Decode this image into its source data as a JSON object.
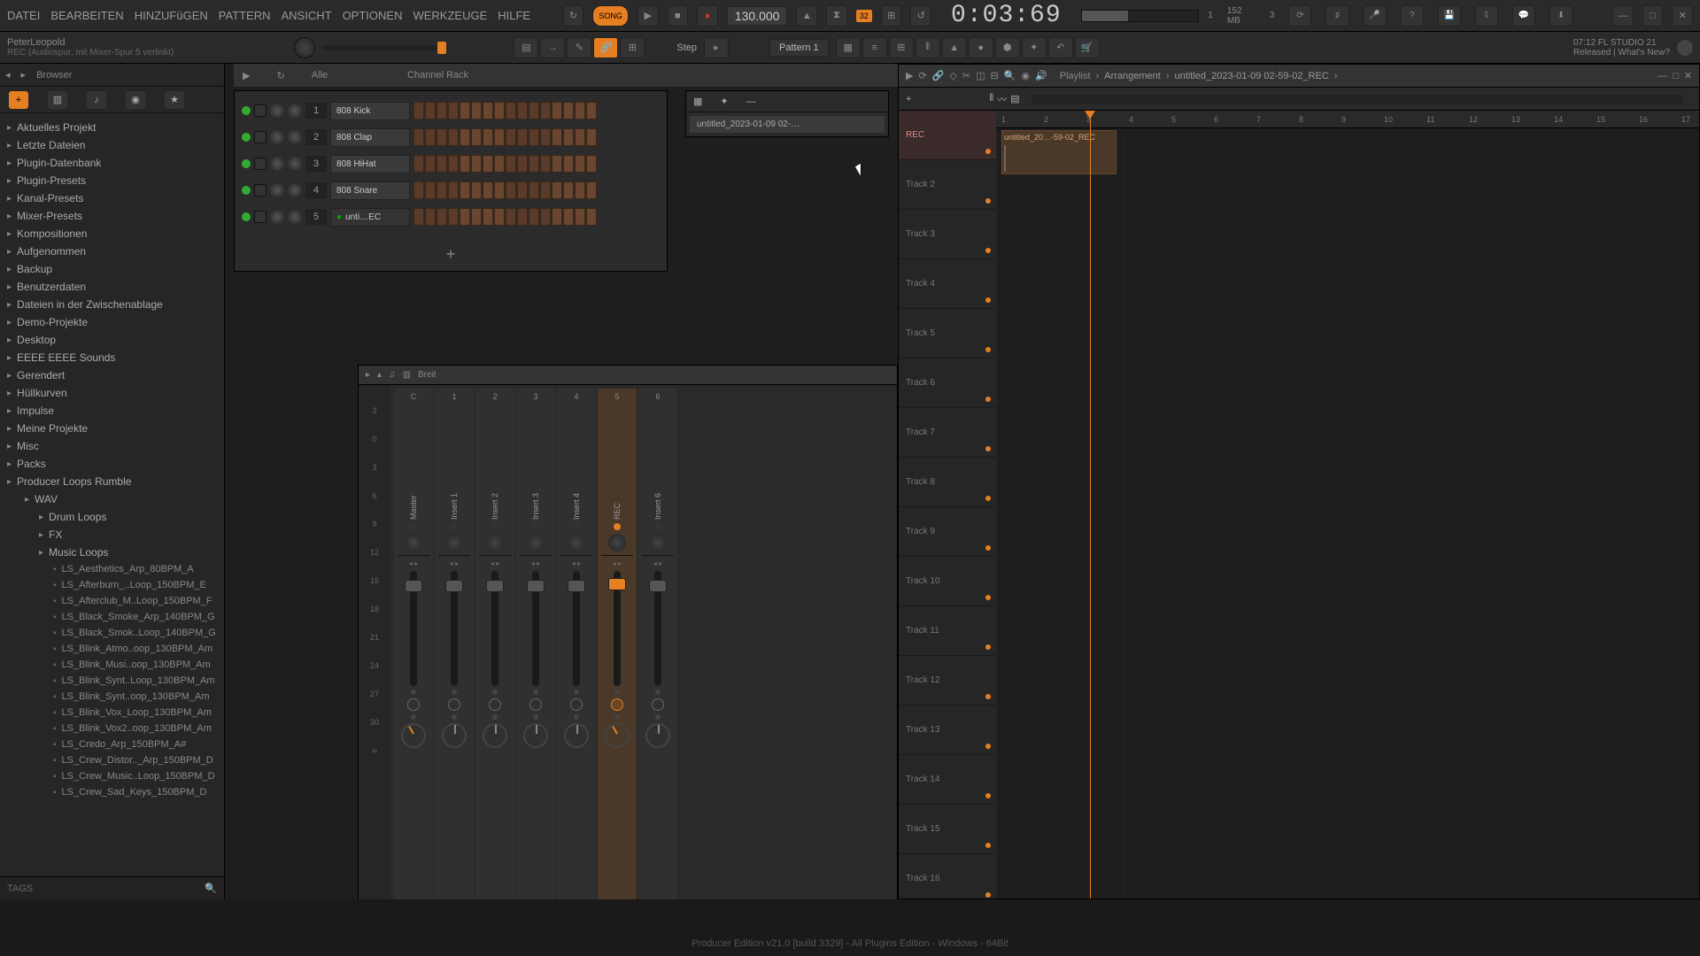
{
  "menu": {
    "items": [
      "DATEI",
      "BEARBEITEN",
      "HINZUFüGEN",
      "PATTERN",
      "ANSICHT",
      "OPTIONEN",
      "WERKZEUGE",
      "HILFE"
    ]
  },
  "transport": {
    "song_label": "SONG",
    "tempo": "130.000",
    "time": "0:03:69",
    "snap_label": "32"
  },
  "stats": {
    "voices": "1",
    "mem": "152 MB",
    "cpu": "3"
  },
  "hint": {
    "title": "PeterLeopold",
    "sub": "REC (Audiospur, mit Mixer-Spur 5 verlinkt)"
  },
  "step_label": "Step",
  "pattern_selector": "Pattern 1",
  "about": {
    "line1": "07:12  FL STUDIO 21",
    "line2": "Released | What's New?"
  },
  "browser": {
    "title": "Browser",
    "filter_label": "Alle",
    "tree": [
      {
        "label": "Aktuelles Projekt",
        "lvl": 0
      },
      {
        "label": "Letzte Dateien",
        "lvl": 0
      },
      {
        "label": "Plugin-Datenbank",
        "lvl": 0
      },
      {
        "label": "Plugin-Presets",
        "lvl": 0
      },
      {
        "label": "Kanal-Presets",
        "lvl": 0
      },
      {
        "label": "Mixer-Presets",
        "lvl": 0
      },
      {
        "label": "Kompositionen",
        "lvl": 0
      },
      {
        "label": "Aufgenommen",
        "lvl": 0
      },
      {
        "label": "Backup",
        "lvl": 0
      },
      {
        "label": "Benutzerdaten",
        "lvl": 0
      },
      {
        "label": "Dateien in der Zwischenablage",
        "lvl": 0
      },
      {
        "label": "Demo-Projekte",
        "lvl": 0
      },
      {
        "label": "Desktop",
        "lvl": 0
      },
      {
        "label": "EEEE EEEE Sounds",
        "lvl": 0
      },
      {
        "label": "Gerendert",
        "lvl": 0
      },
      {
        "label": "Hüllkurven",
        "lvl": 0
      },
      {
        "label": "Impulse",
        "lvl": 0
      },
      {
        "label": "Meine Projekte",
        "lvl": 0
      },
      {
        "label": "Misc",
        "lvl": 0
      },
      {
        "label": "Packs",
        "lvl": 0
      },
      {
        "label": "Producer Loops Rumble",
        "lvl": 0
      },
      {
        "label": "WAV",
        "lvl": 1
      },
      {
        "label": "Drum Loops",
        "lvl": 2
      },
      {
        "label": "FX",
        "lvl": 2
      },
      {
        "label": "Music Loops",
        "lvl": 2
      },
      {
        "label": "LS_Aesthetics_Arp_80BPM_A",
        "lvl": 3
      },
      {
        "label": "LS_Afterburn_..Loop_150BPM_E",
        "lvl": 3
      },
      {
        "label": "LS_Afterclub_M..Loop_150BPM_F",
        "lvl": 3
      },
      {
        "label": "LS_Black_Smoke_Arp_140BPM_G",
        "lvl": 3
      },
      {
        "label": "LS_Black_Smok..Loop_140BPM_G",
        "lvl": 3
      },
      {
        "label": "LS_Blink_Atmo..oop_130BPM_Am",
        "lvl": 3
      },
      {
        "label": "LS_Blink_Musi..oop_130BPM_Am",
        "lvl": 3
      },
      {
        "label": "LS_Blink_Synt..Loop_130BPM_Am",
        "lvl": 3
      },
      {
        "label": "LS_Blink_Synt..oop_130BPM_Am",
        "lvl": 3
      },
      {
        "label": "LS_Blink_Vox_Loop_130BPM_Am",
        "lvl": 3
      },
      {
        "label": "LS_Blink_Vox2..oop_130BPM_Am",
        "lvl": 3
      },
      {
        "label": "LS_Credo_Arp_150BPM_A#",
        "lvl": 3
      },
      {
        "label": "LS_Crew_Distor.._Arp_150BPM_D",
        "lvl": 3
      },
      {
        "label": "LS_Crew_Music..Loop_150BPM_D",
        "lvl": 3
      },
      {
        "label": "LS_Crew_Sad_Keys_150BPM_D",
        "lvl": 3
      }
    ],
    "tags_label": "TAGS"
  },
  "channel_rack": {
    "title": "Channel Rack",
    "channels": [
      {
        "num": "1",
        "name": "808 Kick"
      },
      {
        "num": "2",
        "name": "808 Clap"
      },
      {
        "num": "3",
        "name": "808 HiHat"
      },
      {
        "num": "4",
        "name": "808 Snare"
      },
      {
        "num": "5",
        "name": "unti…EC",
        "rec": true
      }
    ]
  },
  "mixer": {
    "view_label": "Breit",
    "scale": [
      "3",
      "0",
      "3",
      "6",
      "9",
      "12",
      "15",
      "18",
      "21",
      "24",
      "27",
      "30",
      "∞"
    ],
    "tracks": [
      {
        "num": "C",
        "name": "Master"
      },
      {
        "num": "1",
        "name": "Insert 1"
      },
      {
        "num": "2",
        "name": "Insert 2"
      },
      {
        "num": "3",
        "name": "Insert 3"
      },
      {
        "num": "4",
        "name": "Insert 4"
      },
      {
        "num": "5",
        "name": "REC",
        "selected": true
      },
      {
        "num": "6",
        "name": "Insert 6"
      }
    ]
  },
  "playlist": {
    "title": "Playlist",
    "crumb_arrangement": "Arrangement",
    "crumb_file": "untitled_2023-01-09 02-59-02_REC",
    "ruler": [
      "1",
      "2",
      "3",
      "4",
      "5",
      "6",
      "7",
      "8",
      "9",
      "10",
      "11",
      "12",
      "13",
      "14",
      "15",
      "16",
      "17"
    ],
    "tracks": [
      "REC",
      "Track 2",
      "Track 3",
      "Track 4",
      "Track 5",
      "Track 6",
      "Track 7",
      "Track 8",
      "Track 9",
      "Track 10",
      "Track 11",
      "Track 12",
      "Track 13",
      "Track 14",
      "Track 15",
      "Track 16"
    ],
    "clip_name": "untitled_20…-59-02_REC"
  },
  "pattern_strip": {
    "item": "untitled_2023-01-09 02-…"
  },
  "status": "Producer Edition v21.0 [build 3329] - All Plugins Edition - Windows - 64Bit"
}
